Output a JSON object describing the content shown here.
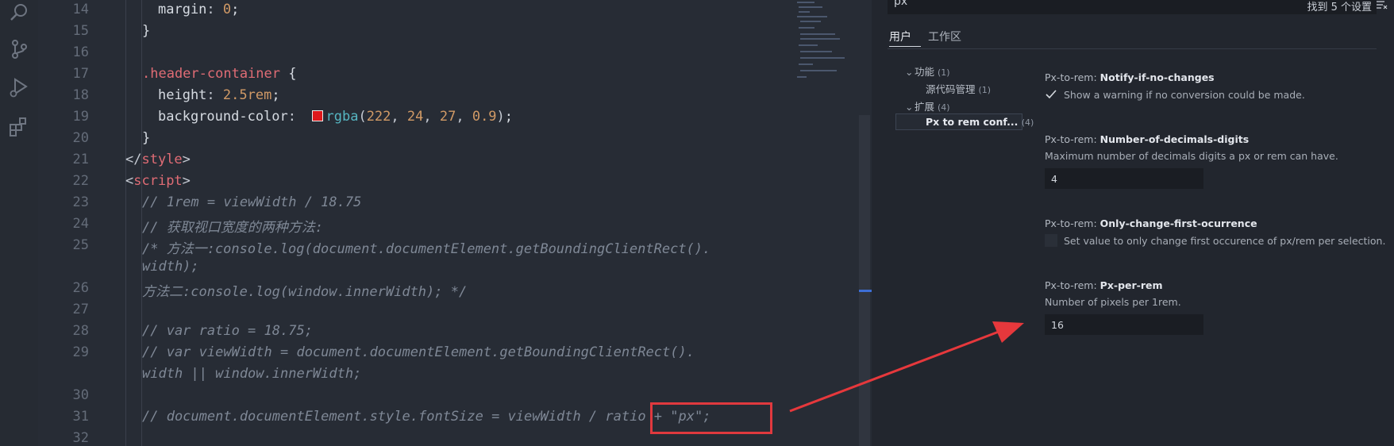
{
  "editor": {
    "lines": [
      {
        "no": "14",
        "code": "margin: 0;"
      },
      {
        "no": "15",
        "code": "}"
      },
      {
        "no": "16",
        "code": ""
      },
      {
        "no": "17",
        "code": ".header-container {"
      },
      {
        "no": "18",
        "code": "height: 2.5rem;"
      },
      {
        "no": "19",
        "code": "background-color: rgba(222, 24, 27, 0.9);"
      },
      {
        "no": "20",
        "code": "}"
      },
      {
        "no": "21",
        "code": "</style>"
      },
      {
        "no": "22",
        "code": "<script>"
      },
      {
        "no": "23",
        "code": "// 1rem = viewWidth / 18.75"
      },
      {
        "no": "24",
        "code": "// 获取视口宽度的两种方法:"
      },
      {
        "no": "25",
        "code": "/* 方法一:console.log(document.documentElement.getBoundingClientRect()."
      },
      {
        "no": "",
        "code": "width);"
      },
      {
        "no": "26",
        "code": "方法二:console.log(window.innerWidth); */"
      },
      {
        "no": "27",
        "code": ""
      },
      {
        "no": "28",
        "code": "// var ratio = 18.75;"
      },
      {
        "no": "29",
        "code": "// var viewWidth = document.documentElement.getBoundingClientRect()."
      },
      {
        "no": "",
        "code": "width || window.innerWidth;"
      },
      {
        "no": "30",
        "code": ""
      },
      {
        "no": "31",
        "code": "// document.documentElement.style.fontSize = viewWidth / ratio + \"px\";"
      },
      {
        "no": "32",
        "code": ""
      }
    ],
    "tokens": {
      "margin": "margin",
      "zero": "0",
      "semi": ";",
      "brace_open": "{",
      "brace_close": "}",
      "selector": ".header-container",
      "height_prop": "height",
      "height_val": "2.5rem",
      "bg_prop": "background-color",
      "rgba_fn": "rgba",
      "r": "222",
      "g": "24",
      "b": "27",
      "a": "0.9",
      "lt": "</",
      "lt2": "<",
      "gt": ">",
      "style_tag": "style",
      "script_tag": "script",
      "c23": "// 1rem = viewWidth / 18.75",
      "c24": "// 获取视口宽度的两种方法:",
      "c25": "/* 方法一:console.log(document.documentElement.getBoundingClientRect().",
      "c25b": "width);",
      "c26": "方法二:console.log(window.innerWidth); */",
      "c28": "// var ratio = 18.75;",
      "c29": "// var viewWidth = document.documentElement.getBoundingClientRect().",
      "c29b": "width || window.innerWidth;",
      "c31a": "// document.documentElement.style.fontSize = viewWidth / ",
      "c31b": "ratio + \"px\";"
    },
    "swatch_color": "#de181b",
    "highlight_color": "#e0393e"
  },
  "activity_bar": {
    "icons": [
      "search-icon",
      "source-control-icon",
      "run-debug-icon",
      "extensions-icon"
    ]
  },
  "settings": {
    "search_value": "px",
    "result_count": "找到 5 个设置",
    "tabs": [
      {
        "label": "用户",
        "active": true
      },
      {
        "label": "工作区",
        "active": false
      }
    ],
    "tree": [
      {
        "label": "功能",
        "count": "(1)",
        "level": 0
      },
      {
        "label": "源代码管理",
        "count": "(1)",
        "level": 1
      },
      {
        "label": "扩展",
        "count": "(4)",
        "level": 0
      },
      {
        "label": "Px to rem conf...",
        "count": "(4)",
        "level": 1
      }
    ],
    "items": [
      {
        "prefix": "Px-to-rem: ",
        "name": "Notify-if-no-changes",
        "description": "Show a warning if no conversion could be made.",
        "type": "checkbox",
        "checked": true
      },
      {
        "prefix": "Px-to-rem: ",
        "name": "Number-of-decimals-digits",
        "description": "Maximum number of decimals digits a px or rem can have.",
        "type": "input",
        "value": "4"
      },
      {
        "prefix": "Px-to-rem: ",
        "name": "Only-change-first-ocurrence",
        "description": "Set value to only change first occurence of px/rem per selection.",
        "type": "checkbox",
        "checked": false
      },
      {
        "prefix": "Px-to-rem: ",
        "name": "Px-per-rem",
        "description": "Number of pixels per 1rem.",
        "type": "input",
        "value": "16"
      }
    ]
  },
  "annotation": {
    "arrow_color": "#e6383c"
  }
}
